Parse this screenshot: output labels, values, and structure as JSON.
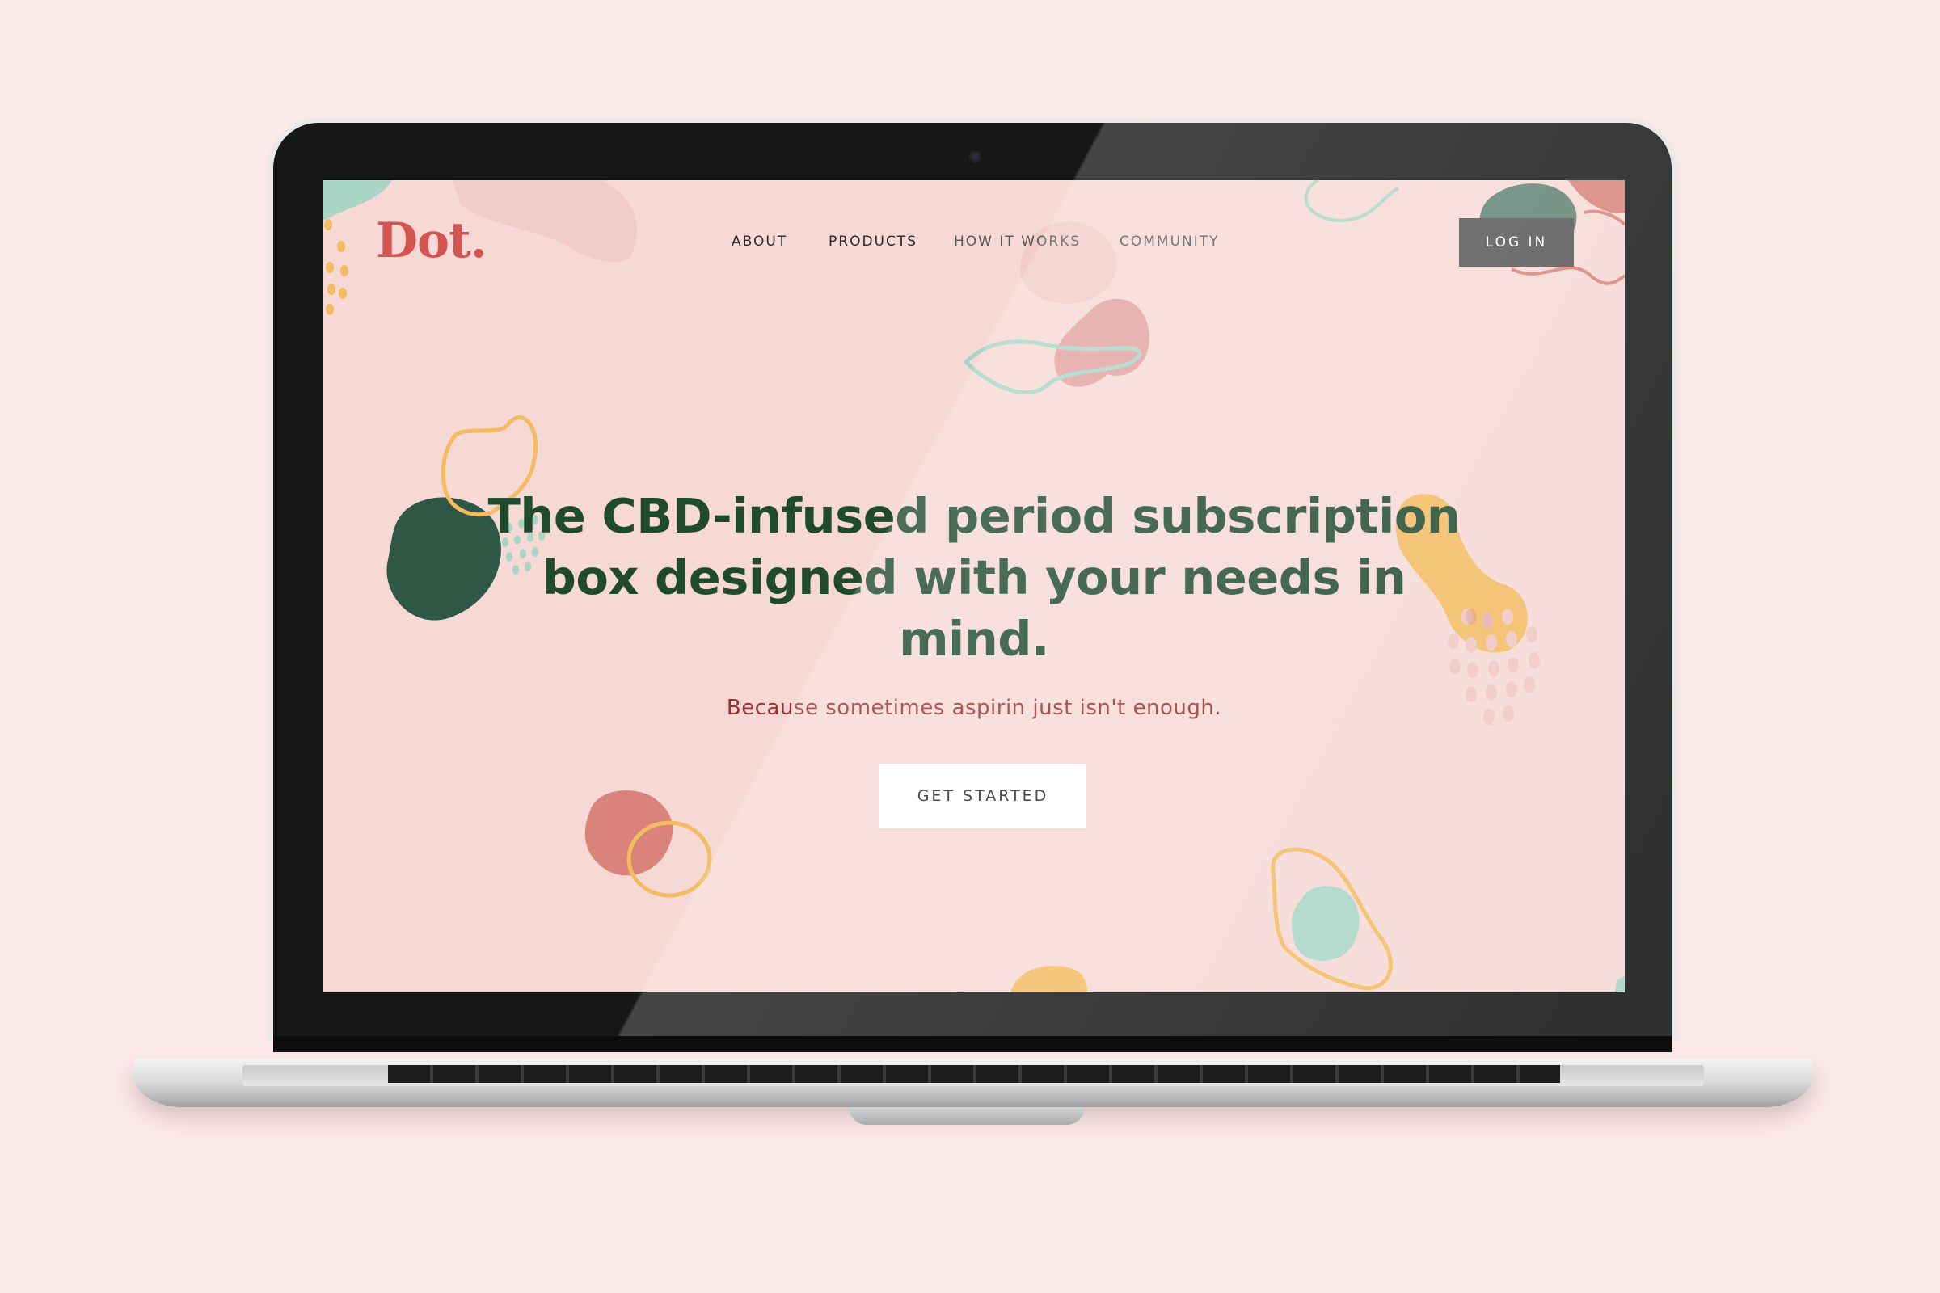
{
  "brand": {
    "logo": "Dot."
  },
  "nav": {
    "items": [
      {
        "label": "ABOUT"
      },
      {
        "label": "PRODUCTS"
      },
      {
        "label": "HOW IT WORKS"
      },
      {
        "label": "COMMUNITY"
      }
    ],
    "login_label": "LOG IN"
  },
  "hero": {
    "headline": "The CBD-infused period subscription box designed with your needs in mind.",
    "subheadline": "Because sometimes aspirin just isn't enough.",
    "cta_label": "GET STARTED"
  },
  "colors": {
    "page_background": "#fbe8e8",
    "screen_background": "#f6d9d5",
    "logo": "#d4544f",
    "headline": "#1f4a2e",
    "subheadline": "#9b2f2f",
    "login_button": "#555557",
    "blob_green": "#2f5746",
    "blob_mint": "#a8d5c6",
    "blob_yellow": "#f3bb62",
    "blob_coral": "#d9837b",
    "blob_pink": "#f0c6c2"
  }
}
